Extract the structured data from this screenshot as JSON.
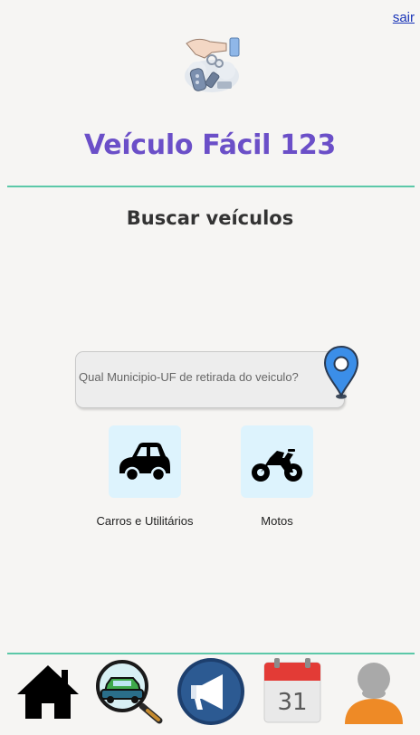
{
  "header": {
    "logout_label": "sair"
  },
  "brand": {
    "title": "Veículo Fácil 123"
  },
  "main": {
    "section_title": "Buscar veículos",
    "search": {
      "placeholder": "Qual Municipio-UF de retirada do veiculo?",
      "value": ""
    },
    "categories": [
      {
        "label": "Carros e Utilitários",
        "icon": "car-icon"
      },
      {
        "label": "Motos",
        "icon": "motorcycle-icon"
      }
    ]
  },
  "bottom_nav": [
    {
      "icon": "home-icon"
    },
    {
      "icon": "search-vehicle-icon"
    },
    {
      "icon": "megaphone-icon"
    },
    {
      "icon": "calendar-icon",
      "text": "31"
    },
    {
      "icon": "user-profile-icon"
    }
  ],
  "colors": {
    "title": "#6b4fc8",
    "divider": "#5cc8a8",
    "category_bg": "#ddf3fd",
    "link": "#1a35b8",
    "pin": "#3b8ee8"
  }
}
